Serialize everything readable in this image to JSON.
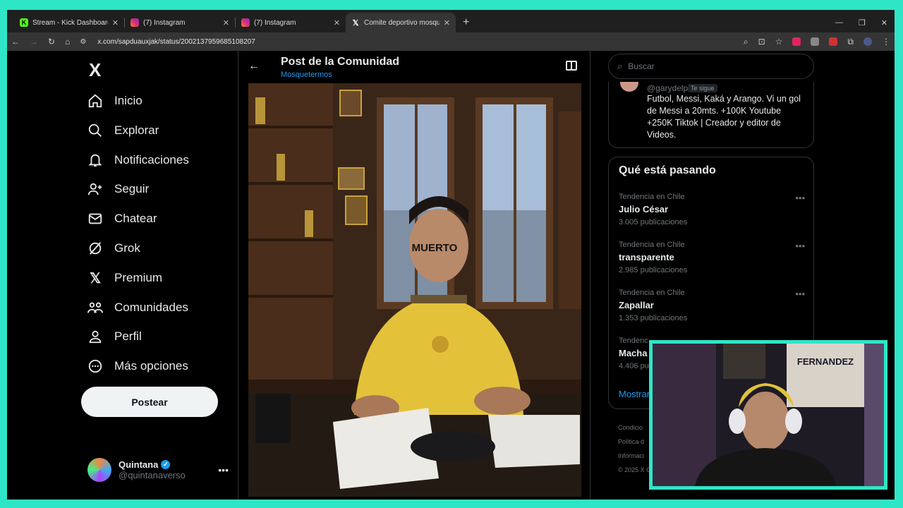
{
  "browser": {
    "tabs": [
      {
        "label": "Stream - Kick Dashboard",
        "favicon": "kick-icon",
        "color": "#53fc18"
      },
      {
        "label": "(7) Instagram",
        "favicon": "instagram-icon",
        "color": "#e1306c"
      },
      {
        "label": "(7) Instagram",
        "favicon": "instagram-icon",
        "color": "#e1306c"
      },
      {
        "label": "Comite deportivo mosqueterm...",
        "favicon": "x-icon",
        "color": "#ffffff"
      }
    ],
    "url": "x.com/sapduauxjak/status/2002137959685108207"
  },
  "nav": {
    "logo": "X",
    "items": [
      {
        "label": "Inicio",
        "icon": "home-icon"
      },
      {
        "label": "Explorar",
        "icon": "search-icon"
      },
      {
        "label": "Notificaciones",
        "icon": "bell-icon"
      },
      {
        "label": "Seguir",
        "icon": "add-user-icon"
      },
      {
        "label": "Chatear",
        "icon": "mail-icon"
      },
      {
        "label": "Grok",
        "icon": "grok-icon"
      },
      {
        "label": "Premium",
        "icon": "x-premium-icon"
      },
      {
        "label": "Comunidades",
        "icon": "communities-icon"
      },
      {
        "label": "Perfil",
        "icon": "person-icon"
      },
      {
        "label": "Más opciones",
        "icon": "more-circle-icon"
      }
    ],
    "post_label": "Postear",
    "profile": {
      "name": "Quintana",
      "handle": "@quintanaverso"
    }
  },
  "center": {
    "title": "Post de la Comunidad",
    "subtitle": "Mosquetermos",
    "image_text": "MUERTO"
  },
  "right": {
    "search_placeholder": "Buscar",
    "suggested": {
      "handle": "@garydelphi...",
      "follows_you": "Te sigue",
      "bio": "Futbol, Messi, Kaká y Arango. Vi un gol de Messi a 20mts. +100K Youtube +250K Tiktok | Creador y editor de Videos."
    },
    "trends_title": "Qué está pasando",
    "trends": [
      {
        "context": "Tendencia en Chile",
        "name": "Julio César",
        "count": "3.005 publicaciones"
      },
      {
        "context": "Tendencia en Chile",
        "name": "transparente",
        "count": "2.985 publicaciones"
      },
      {
        "context": "Tendencia en Chile",
        "name": "Zapallar",
        "count": "1.353 publicaciones"
      },
      {
        "context": "Tendenc",
        "name": "Macha",
        "count": "4.406 pu"
      }
    ],
    "show_more": "Mostrar",
    "footer": [
      "Condicio",
      "Política d",
      "Informaci",
      "© 2025 X C"
    ]
  },
  "webcam": {
    "sign_text": "FERNANDEZ"
  }
}
